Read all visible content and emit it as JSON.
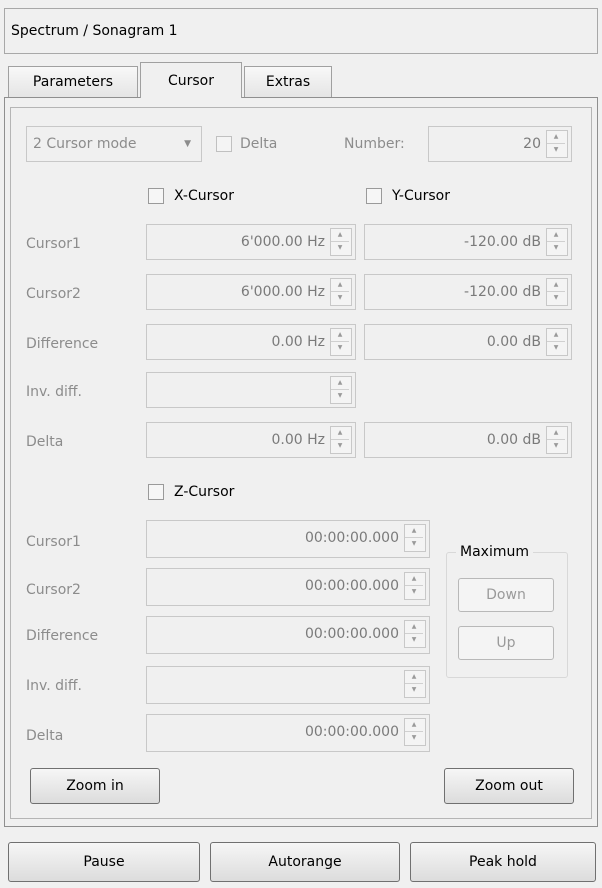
{
  "window": {
    "title": "Spectrum / Sonagram 1"
  },
  "tabs": [
    {
      "label": "Parameters",
      "active": false
    },
    {
      "label": "Cursor",
      "active": true
    },
    {
      "label": "Extras",
      "active": false
    }
  ],
  "cursor_mode": {
    "selected": "2 Cursor mode",
    "delta_label": "Delta",
    "number_label": "Number:",
    "number_value": "20"
  },
  "xy_section": {
    "x_label": "X-Cursor",
    "y_label": "Y-Cursor",
    "rows": [
      {
        "label": "Cursor1",
        "x": "6'000.00 Hz",
        "y": "-120.00 dB"
      },
      {
        "label": "Cursor2",
        "x": "6'000.00 Hz",
        "y": "-120.00 dB"
      },
      {
        "label": "Difference",
        "x": "0.00 Hz",
        "y": "0.00 dB"
      },
      {
        "label": "Inv. diff.",
        "x": "",
        "y": null
      },
      {
        "label": "Delta",
        "x": "0.00 Hz",
        "y": "0.00 dB"
      }
    ]
  },
  "z_section": {
    "z_label": "Z-Cursor",
    "rows": [
      {
        "label": "Cursor1",
        "value": "00:00:00.000"
      },
      {
        "label": "Cursor2",
        "value": "00:00:00.000"
      },
      {
        "label": "Difference",
        "value": "00:00:00.000"
      },
      {
        "label": "Inv. diff.",
        "value": ""
      },
      {
        "label": "Delta",
        "value": "00:00:00.000"
      }
    ]
  },
  "maximum": {
    "title": "Maximum",
    "down": "Down",
    "up": "Up"
  },
  "zoom": {
    "in": "Zoom in",
    "out": "Zoom out"
  },
  "bottom_buttons": {
    "pause": "Pause",
    "autorange": "Autorange",
    "peak_hold": "Peak hold"
  }
}
